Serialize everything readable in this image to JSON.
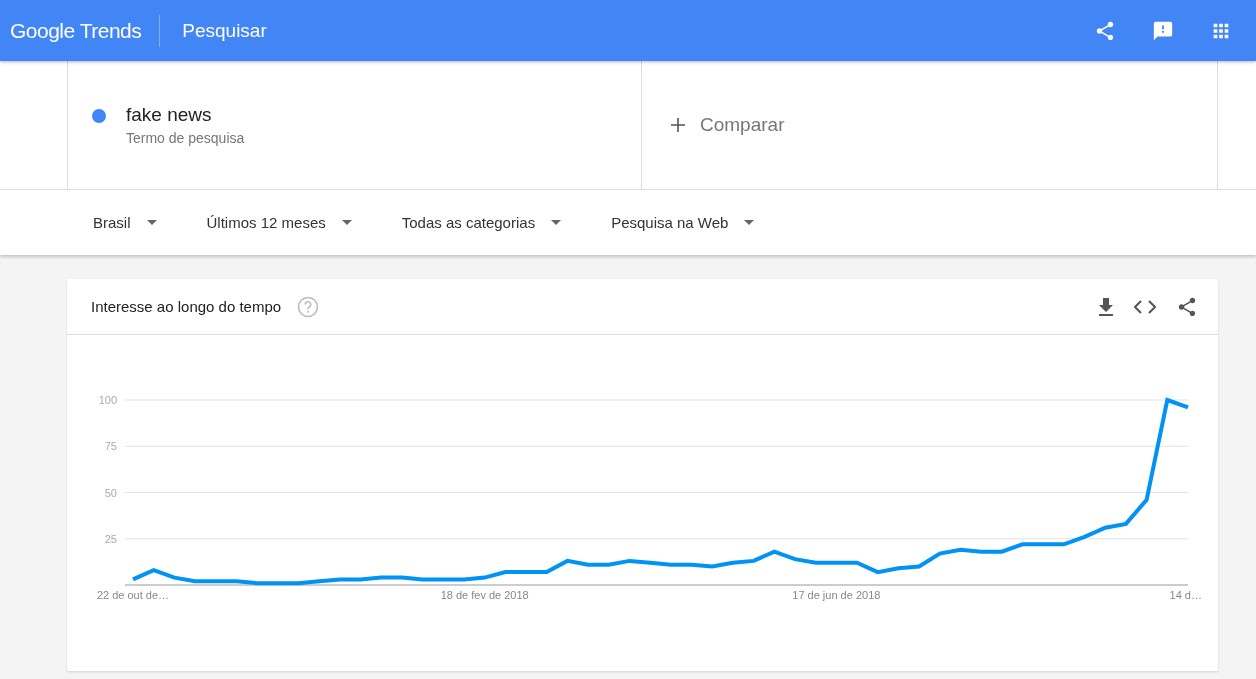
{
  "header": {
    "logo": "Google Trends",
    "title": "Pesquisar"
  },
  "search_terms": [
    {
      "term": "fake news",
      "sublabel": "Termo de pesquisa",
      "color": "#4285f4"
    }
  ],
  "compare": {
    "label": "Comparar"
  },
  "filters": [
    {
      "label": "Brasil"
    },
    {
      "label": "Últimos 12 meses"
    },
    {
      "label": "Todas as categorias"
    },
    {
      "label": "Pesquisa na Web"
    }
  ],
  "interest_card": {
    "title": "Interesse ao longo do tempo",
    "chart_data": {
      "type": "line",
      "categories": [
        "22 de out de…",
        null,
        null,
        null,
        null,
        null,
        null,
        null,
        null,
        null,
        null,
        null,
        null,
        null,
        null,
        null,
        null,
        "18 de fev de 2018",
        null,
        null,
        null,
        null,
        null,
        null,
        null,
        null,
        null,
        null,
        null,
        null,
        null,
        null,
        null,
        null,
        "17 de jun de 2018",
        null,
        null,
        null,
        null,
        null,
        null,
        null,
        null,
        null,
        null,
        null,
        null,
        null,
        null,
        null,
        null,
        "14 d…"
      ],
      "series": [
        {
          "color": "#0092f5",
          "values": [
            3,
            8,
            4,
            2,
            2,
            2,
            1,
            1,
            1,
            2,
            3,
            3,
            4,
            4,
            3,
            3,
            3,
            4,
            7,
            7,
            7,
            13,
            11,
            11,
            13,
            12,
            11,
            11,
            10,
            12,
            13,
            18,
            14,
            12,
            12,
            12,
            7,
            9,
            10,
            17,
            19,
            18,
            18,
            22,
            22,
            22,
            26,
            31,
            33,
            46,
            100,
            96
          ]
        }
      ],
      "grid": true,
      "ylim": [
        0,
        100
      ],
      "yticks": [
        25,
        50,
        75,
        100
      ]
    }
  }
}
